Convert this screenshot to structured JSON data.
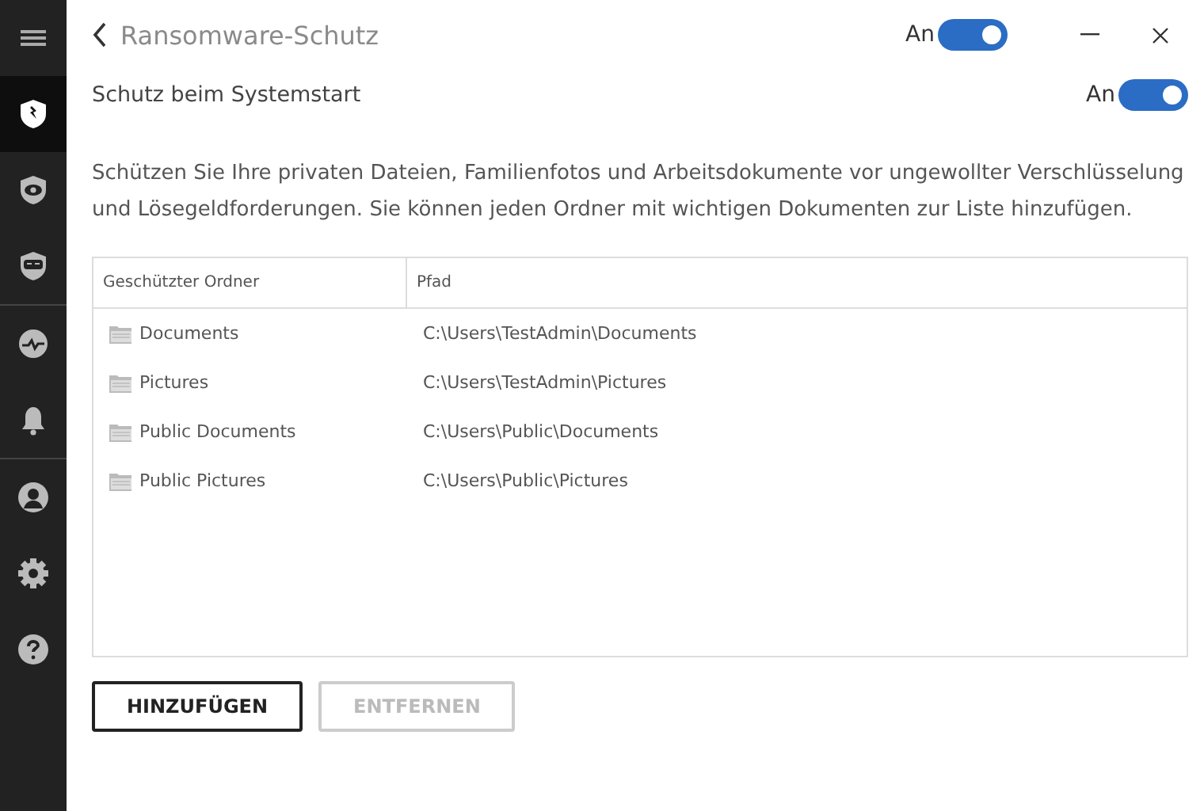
{
  "sidebar": {
    "groups": [
      {
        "items": [
          {
            "kind": "menu",
            "selected": false
          },
          {
            "kind": "shield",
            "selected": true
          },
          {
            "kind": "eye",
            "selected": false
          },
          {
            "kind": "badge",
            "selected": false
          }
        ]
      },
      {
        "items": [
          {
            "kind": "pulse",
            "selected": false
          },
          {
            "kind": "bell",
            "selected": false
          }
        ]
      },
      {
        "items": [
          {
            "kind": "user",
            "selected": false
          },
          {
            "kind": "gear",
            "selected": false
          },
          {
            "kind": "help",
            "selected": false
          }
        ]
      }
    ]
  },
  "header": {
    "title": "Ransomware-Schutz",
    "toggle": {
      "label": "An",
      "on": true
    }
  },
  "startup": {
    "label": "Schutz beim Systemstart",
    "toggle": {
      "label": "An",
      "on": true
    }
  },
  "description": "Schützen Sie Ihre privaten Dateien, Familienfotos und Arbeitsdokumente vor ungewollter Verschlüsselung und Lösegeldforderungen. Sie können jeden Ordner mit wichtigen Dokumenten zur Liste hinzufügen.",
  "table": {
    "columns": [
      "Geschützter Ordner",
      "Pfad"
    ],
    "rows": [
      {
        "folder": "Documents",
        "path": "C:\\Users\\TestAdmin\\Documents"
      },
      {
        "folder": "Pictures",
        "path": "C:\\Users\\TestAdmin\\Pictures"
      },
      {
        "folder": "Public Documents",
        "path": "C:\\Users\\Public\\Documents"
      },
      {
        "folder": "Public Pictures",
        "path": "C:\\Users\\Public\\Pictures"
      }
    ]
  },
  "buttons": [
    {
      "label": "HINZUFÜGEN",
      "disabled": false
    },
    {
      "label": "ENTFERNEN",
      "disabled": true
    }
  ]
}
